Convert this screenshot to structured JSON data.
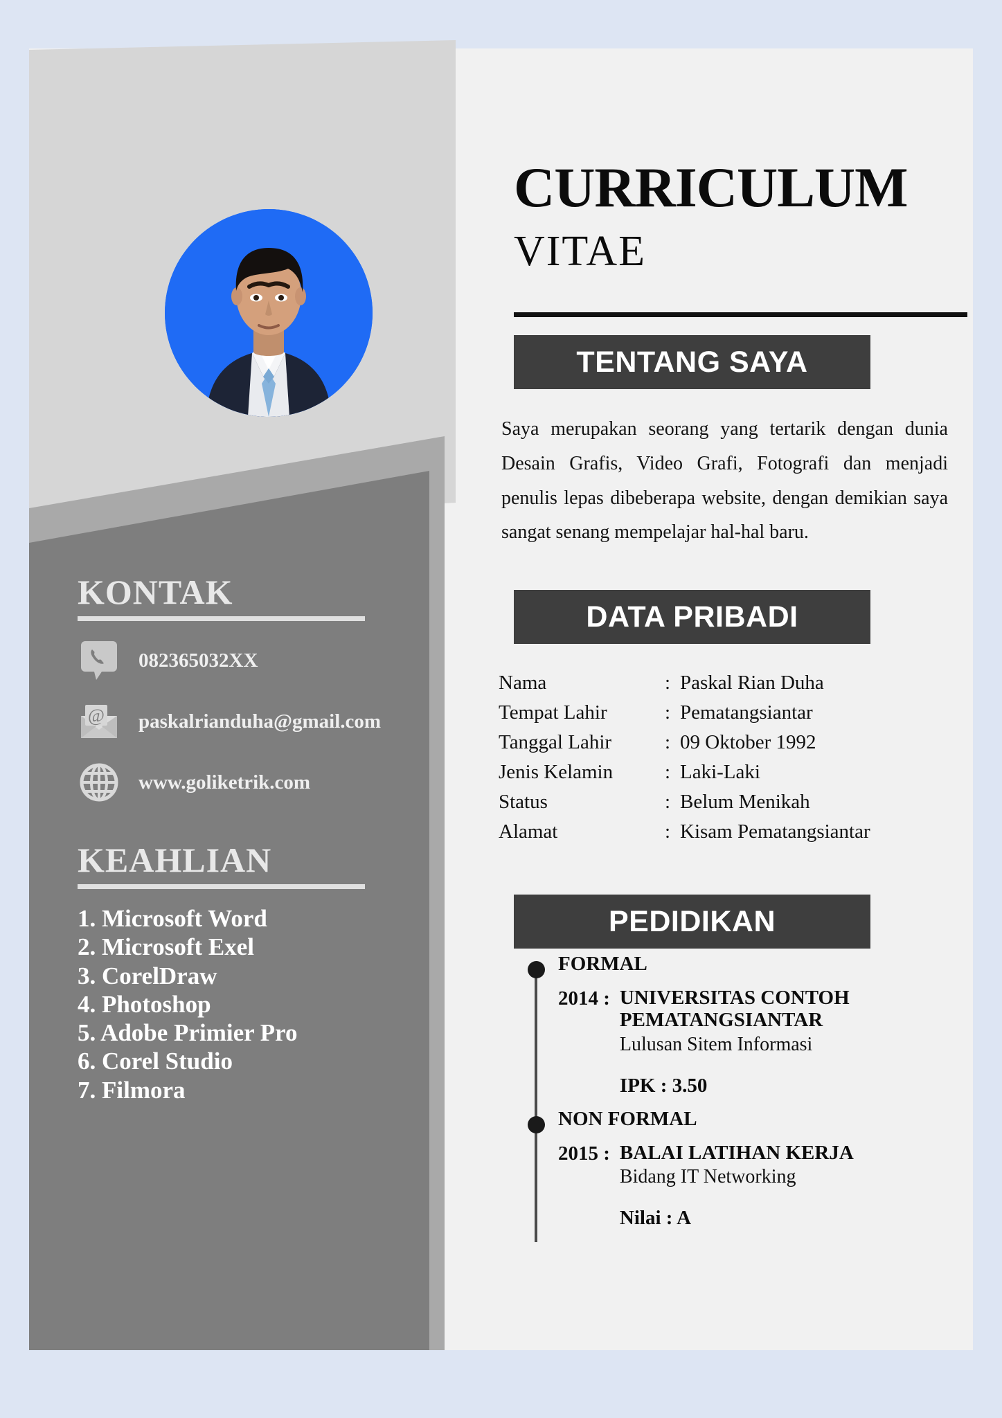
{
  "document": {
    "title_line1": "CURRICULUM",
    "title_line2": "VITAE"
  },
  "theme": {
    "page_background": "#dde5f3",
    "sheet_background": "#f1f1f1",
    "section_bar": "#3e3e3e",
    "sidebar_dark": "#7e7e7e",
    "sidebar_mid": "#a9a9a9",
    "sidebar_light": "#d6d6d6",
    "photo_background": "#1f6bf5",
    "text_dark": "#111111",
    "text_light": "#efefef"
  },
  "sections": {
    "about": {
      "heading": "TENTANG SAYA",
      "paragraph": "Saya merupakan seorang yang tertarik dengan dunia Desain Grafis, Video Grafi, Fotografi dan menjadi penulis lepas dibeberapa website, dengan demikian saya sangat senang mempelajar hal-hal baru."
    },
    "personal": {
      "heading": "DATA PRIBADI",
      "separator": ":",
      "rows": [
        {
          "label": "Nama",
          "value": "Paskal Rian Duha"
        },
        {
          "label": "Tempat Lahir",
          "value": "Pematangsiantar"
        },
        {
          "label": "Tanggal Lahir",
          "value": "09 Oktober 1992"
        },
        {
          "label": "Jenis Kelamin",
          "value": "Laki-Laki"
        },
        {
          "label": "Status",
          "value": "Belum Menikah"
        },
        {
          "label": "Alamat",
          "value": "Kisam Pematangsiantar"
        }
      ]
    },
    "education": {
      "heading": "PEDIDIKAN",
      "formal": {
        "kind": "FORMAL",
        "year": "2014 :",
        "institution_line1": "UNIVERSITAS CONTOH",
        "institution_line2": "PEMATANGSIANTAR",
        "description": "Lulusan Sitem Informasi",
        "score": "IPK : 3.50"
      },
      "non_formal": {
        "kind": "NON FORMAL",
        "year": "2015 :",
        "institution_line1": "BALAI LATIHAN KERJA",
        "institution_line2": "",
        "description": "Bidang IT Networking",
        "score": "Nilai : A"
      }
    },
    "contact": {
      "heading": "KONTAK",
      "items": [
        {
          "icon": "phone-icon",
          "value": "082365032XX"
        },
        {
          "icon": "email-icon",
          "value": "paskalrianduha@gmail.com"
        },
        {
          "icon": "globe-icon",
          "value": "www.goliketrik.com"
        }
      ]
    },
    "skills": {
      "heading": "KEAHLIAN",
      "items": [
        "1. Microsoft Word",
        "2. Microsoft Exel",
        "3. CorelDraw",
        "4. Photoshop",
        "5. Adobe Primier Pro",
        "6. Corel Studio",
        "7. Filmora"
      ]
    }
  }
}
